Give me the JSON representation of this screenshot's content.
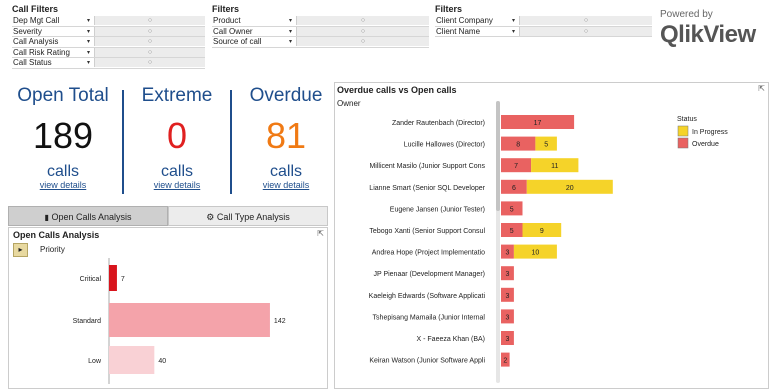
{
  "filters_call": {
    "title": "Call Filters",
    "items": [
      "Dep Mgt Call",
      "Severity",
      "Call Analysis",
      "Call Risk Rating",
      "Call Status"
    ]
  },
  "filters_product": {
    "title": "Filters",
    "items": [
      "Product",
      "Call Owner",
      "Source of call"
    ]
  },
  "filters_client": {
    "title": "Filters",
    "items": [
      "Client Company",
      "Client Name"
    ]
  },
  "logo": {
    "powered": "Powered by",
    "name": "QlikView"
  },
  "kpis": [
    {
      "title": "Open Total",
      "value": "189",
      "unit": "calls",
      "link": "view details",
      "color": "#111111"
    },
    {
      "title": "Extreme",
      "value": "0",
      "unit": "calls",
      "link": "view details",
      "color": "#e02020"
    },
    {
      "title": "Overdue",
      "value": "81",
      "unit": "calls",
      "link": "view details",
      "color": "#f07a14"
    }
  ],
  "tabs": [
    "Open Calls Analysis",
    "Call Type Analysis"
  ],
  "priority_panel": {
    "title": "Open Calls Analysis",
    "dim_label": "Priority"
  },
  "overdue_panel": {
    "title": "Overdue calls vs Open calls",
    "dim_label": "Owner"
  },
  "colors": {
    "in_progress": "#f5d329",
    "overdue": "#e96261",
    "priority_critical": "#d8141c",
    "priority_standard": "#f4a3aa",
    "priority_low": "#f9d1d5",
    "brand": "#1f4e8c"
  },
  "chart_data": [
    {
      "type": "bar",
      "title": "Open Calls Analysis",
      "xlabel": "Priority",
      "categories": [
        "Critical",
        "Standard",
        "Low"
      ],
      "values": [
        7,
        142,
        40
      ]
    },
    {
      "type": "bar",
      "title": "Overdue calls vs Open calls",
      "xlabel": "Owner",
      "legend_title": "Status",
      "categories": [
        "Zander Rautenbach (Director)",
        "Lucille Hallowes (Director)",
        "Millicent Masilo (Junior Support Cons",
        "Lianne Smart (Senior SQL Developer",
        "Eugene Jansen (Junior Tester)",
        "Tebogo Xanti (Senior Support Consul",
        "Andrea Hope (Project Implementatio",
        "JP Pienaar (Development Manager)",
        "Kaeleigh Edwards (Software Applicati",
        "Tshepisang Mamaila (Junior Internal",
        "X - Faeeza Khan (BA)",
        "Keiran Watson (Junior Software Appli"
      ],
      "series": [
        {
          "name": "Overdue",
          "values": [
            17,
            8,
            7,
            6,
            5,
            5,
            3,
            3,
            3,
            3,
            3,
            2
          ]
        },
        {
          "name": "In Progress",
          "values": [
            0,
            5,
            11,
            20,
            0,
            9,
            10,
            0,
            0,
            0,
            0,
            0
          ]
        }
      ]
    }
  ]
}
